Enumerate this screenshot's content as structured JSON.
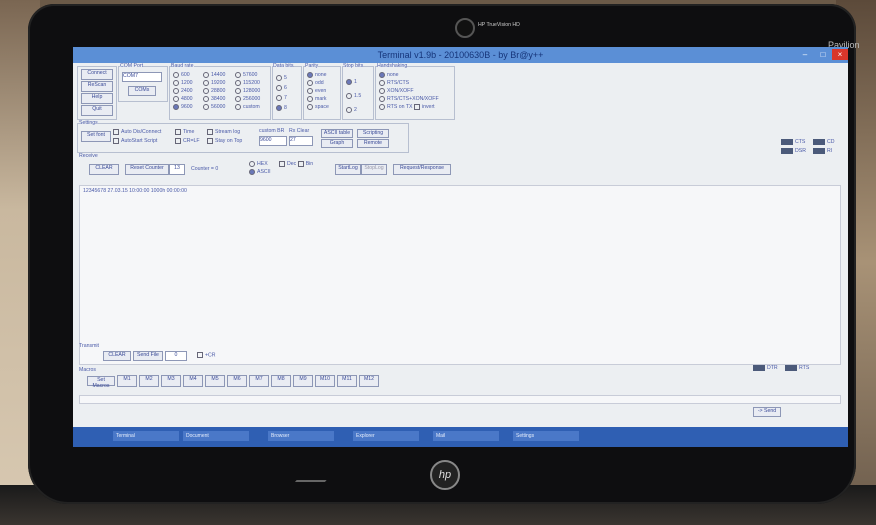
{
  "bezel": {
    "camera_label": "HP TrueVision HD",
    "brand": "Pavilion",
    "logo": "hp"
  },
  "window": {
    "title": "Terminal v1.9b - 20100630B - by Br@y++",
    "controls": {
      "min": "–",
      "max": "□",
      "close": "×"
    }
  },
  "connection": {
    "title": "",
    "buttons": [
      "Connect",
      "ReScan",
      "Help",
      "Quit"
    ],
    "com_port_label": "COM Port",
    "com_port_value": "COM7",
    "com_port_button": "COMs"
  },
  "baud_rate": {
    "title": "Baud rate",
    "options": [
      "600",
      "1200",
      "2400",
      "4800",
      "9600",
      "14400",
      "19200",
      "28800",
      "38400",
      "56000",
      "57600",
      "115200",
      "128000",
      "256000",
      "custom"
    ],
    "selected": "9600"
  },
  "data_bits": {
    "title": "Data bits",
    "options": [
      "5",
      "6",
      "7",
      "8"
    ],
    "selected": "8"
  },
  "parity": {
    "title": "Parity",
    "options": [
      "none",
      "odd",
      "even",
      "mark",
      "space"
    ],
    "selected": "none"
  },
  "stop_bits": {
    "title": "Stop bits",
    "options": [
      "1",
      "1.5",
      "2"
    ],
    "selected": "1"
  },
  "handshaking": {
    "title": "Handshaking",
    "options": [
      "none",
      "RTS/CTS",
      "XON/XOFF",
      "RTS/CTS+XON/XOFF",
      "RTS on TX"
    ],
    "invert_label": "invert",
    "selected": "none"
  },
  "settings": {
    "title": "Settings",
    "set_font": "Set font",
    "checks": [
      "Auto Dis/Connect",
      "AutoStart Script",
      "Time",
      "CR=LF",
      "Stream log",
      "Stay on Top"
    ],
    "custom_br_label": "custom BR",
    "custom_br_value": "9600",
    "rx_clear_label": "Rx Clear",
    "rx_clear_value": "27",
    "ascii_table": "ASCII table",
    "graph": "Graph",
    "scripting": "Scripting",
    "remote": "Remote"
  },
  "receive": {
    "title": "Receive",
    "clear": "CLEAR",
    "reset_counter": "Reset Counter",
    "counter_value": "13",
    "counter_label": "Counter = 0",
    "formats": [
      "HEX",
      "ASCII",
      "Dec",
      "Bin"
    ],
    "selected_format": "ASCII",
    "start_log": "StartLog",
    "stop_log": "StopLog",
    "request_response": "Request/Response",
    "output_line": "12345678 27.03.15 10:00:00 1000h 00:00:00"
  },
  "status_leds": [
    "CTS",
    "CD",
    "DSR",
    "RI"
  ],
  "transmit": {
    "title": "Transmit",
    "clear": "CLEAR",
    "send_file": "Send File",
    "counter_value": "0",
    "cr_label": "+CR",
    "macros_label": "Macros",
    "set_macros": "Set Macros",
    "macros": [
      "M1",
      "M2",
      "M3",
      "M4",
      "M5",
      "M6",
      "M7",
      "M8",
      "M9",
      "M10",
      "M11",
      "M12"
    ],
    "send_button": "-> Send",
    "dtr_label": "DTR",
    "rts_label": "RTS"
  },
  "taskbar": {
    "items": [
      "Terminal",
      "Document",
      "Browser",
      "Explorer",
      "Mail",
      "Settings"
    ]
  }
}
